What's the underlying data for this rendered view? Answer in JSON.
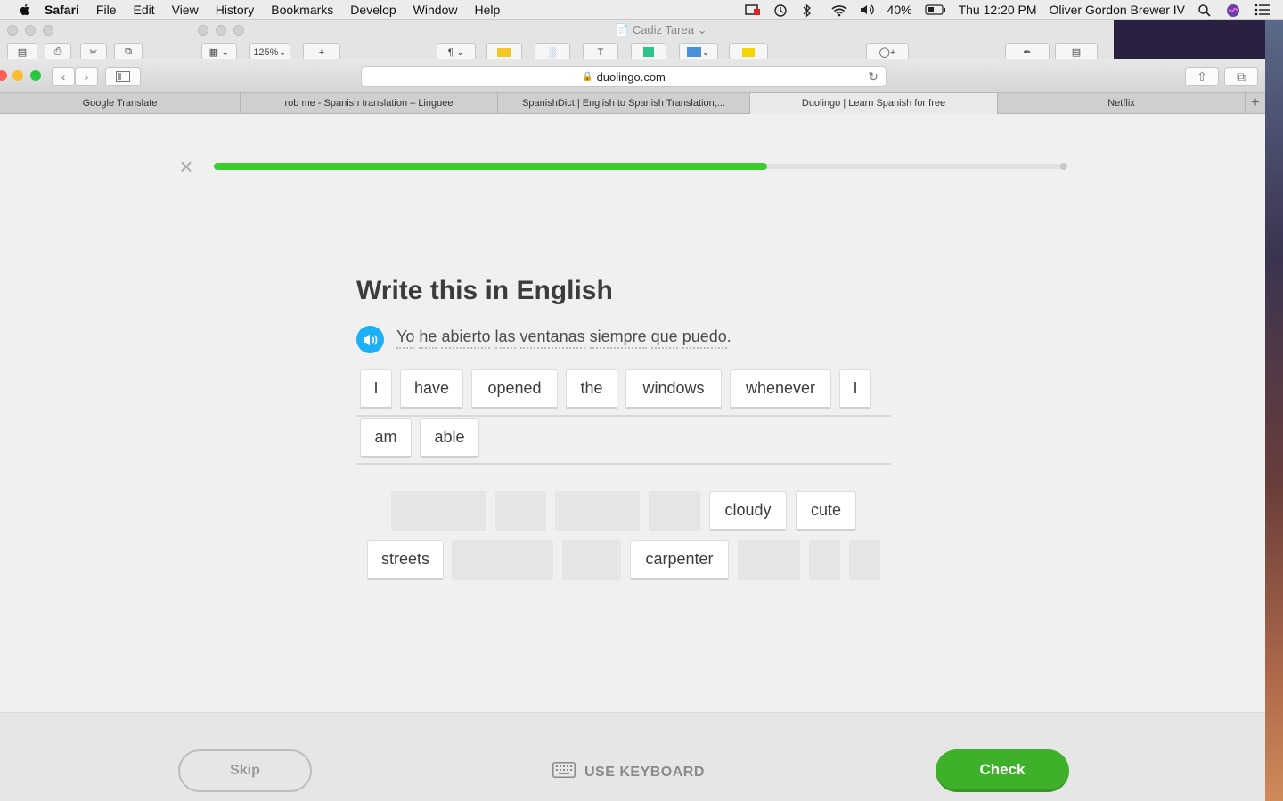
{
  "menubar": {
    "app_name": "Safari",
    "menus": [
      "File",
      "Edit",
      "View",
      "History",
      "Bookmarks",
      "Develop",
      "Window",
      "Help"
    ],
    "battery": "40%",
    "clock": "Thu 12:20 PM",
    "user": "Oliver Gordon Brewer IV"
  },
  "pages_window": {
    "title": "Cadiz Tarea",
    "zoom": "125%"
  },
  "browser": {
    "url": "duolingo.com",
    "tabs": [
      {
        "label": "Google Translate"
      },
      {
        "label": "rob me - Spanish translation – Linguee"
      },
      {
        "label": "SpanishDict | English to Spanish Translation,..."
      },
      {
        "label": "Duolingo | Learn Spanish for free"
      },
      {
        "label": "Netflix"
      }
    ],
    "active_tab_index": 3
  },
  "lesson": {
    "progress_fraction": 0.65,
    "prompt_title": "Write this in English",
    "sentence_words": [
      "Yo",
      "he",
      "abierto",
      "las",
      "ventanas",
      "siempre",
      "que",
      "puedo"
    ],
    "sentence_end": ".",
    "selected_words": [
      "I",
      "have",
      "opened",
      "the",
      "windows",
      "whenever",
      "I",
      "am",
      "able"
    ],
    "bank_words": [
      "cloudy",
      "cute",
      "streets",
      "carpenter"
    ]
  },
  "footer": {
    "skip_label": "Skip",
    "keyboard_label": "USE KEYBOARD",
    "check_label": "Check"
  },
  "colors": {
    "progress": "#3ecb2c",
    "check_button": "#3fb02a",
    "speaker": "#1cb0f6"
  }
}
